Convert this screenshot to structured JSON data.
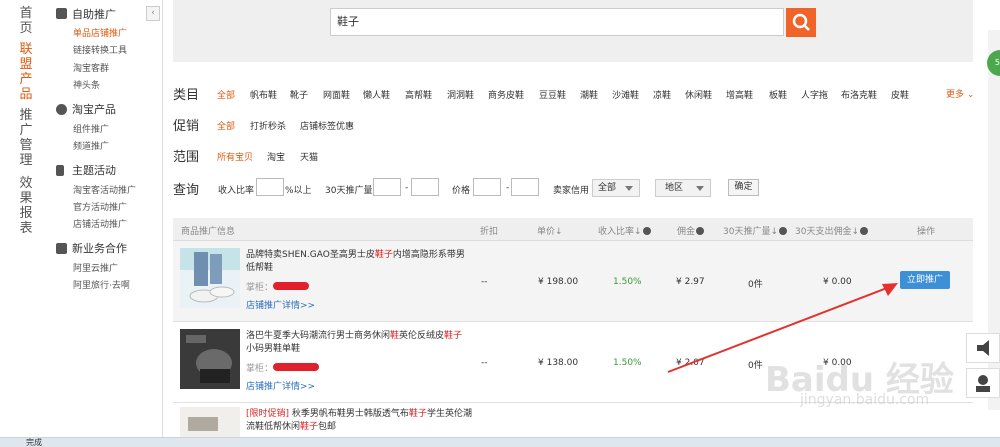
{
  "left_nav": [
    {
      "label": "首页",
      "active": false
    },
    {
      "label": "联盟产品",
      "active": true
    },
    {
      "label": "推广管理",
      "active": false
    },
    {
      "label": "效果报表",
      "active": false
    }
  ],
  "sidebar": {
    "sections": [
      {
        "title": "自助推广",
        "icon": "megaphone-icon",
        "items": [
          {
            "label": "单品店铺推广",
            "active": true
          },
          {
            "label": "链接转换工具",
            "active": false
          },
          {
            "label": "淘宝客群",
            "active": false
          },
          {
            "label": "神头条",
            "active": false
          }
        ]
      },
      {
        "title": "淘宝产品",
        "icon": "taobao-icon",
        "items": [
          {
            "label": "组件推广",
            "active": false
          },
          {
            "label": "频道推广",
            "active": false
          }
        ]
      },
      {
        "title": "主题活动",
        "icon": "flag-icon",
        "items": [
          {
            "label": "淘宝客活动推广",
            "active": false
          },
          {
            "label": "官方活动推广",
            "active": false
          },
          {
            "label": "店铺活动推广",
            "active": false
          }
        ]
      },
      {
        "title": "新业务合作",
        "icon": "handshake-icon",
        "items": [
          {
            "label": "阿里云推广",
            "active": false
          },
          {
            "label": "阿里旅行·去啊",
            "active": false
          }
        ]
      }
    ]
  },
  "search": {
    "value": "鞋子",
    "button_icon": "search-icon"
  },
  "filters": {
    "category_label": "类目",
    "categories": [
      "全部",
      "帆布鞋",
      "靴子",
      "网面鞋",
      "懒人鞋",
      "高帮鞋",
      "洞洞鞋",
      "商务皮鞋",
      "豆豆鞋",
      "潮鞋",
      "沙滩鞋",
      "凉鞋",
      "休闲鞋",
      "增高鞋",
      "板鞋",
      "人字拖",
      "布洛克鞋",
      "皮鞋"
    ],
    "more_label": "更多",
    "promo_label": "促销",
    "promos": [
      "全部",
      "打折秒杀",
      "店铺标签优惠"
    ],
    "scope_label": "范围",
    "scopes": [
      "所有宝贝",
      "淘宝",
      "天猫"
    ],
    "query_label": "查询",
    "ratio_label": "收入比率",
    "ratio_suffix": "%以上",
    "volume_label": "30天推广量",
    "price_label": "价格",
    "dash": "-",
    "credit_label": "卖家信用",
    "credit_value": "全部",
    "region_value": "地区",
    "confirm_label": "确定"
  },
  "table": {
    "headers": {
      "info": "商品推广信息",
      "discount": "折扣",
      "price": "单价",
      "ratio": "收入比率",
      "commission": "佣金",
      "volume": "30天推广量",
      "spend": "30天支出佣金",
      "action": "操作"
    },
    "rows": [
      {
        "title_parts": [
          "品牌特卖SHEN.GAO圣高男士皮",
          "鞋",
          "内增高隐形系带男低帮鞋"
        ],
        "title_hl": "鞋子",
        "seller_label": "掌柜：",
        "link": "店铺推广详情>>",
        "discount": "--",
        "price": "¥ 198.00",
        "ratio": "1.50%",
        "commission": "¥ 2.97",
        "volume": "0件",
        "spend": "¥ 0.00",
        "action": "立即推广"
      },
      {
        "title_a": "洛巴牛夏季大码潮流行男士商务休闲",
        "title_b": "英伦反绒皮",
        "title_c": "小码男鞋单鞋",
        "title_hl": "鞋子",
        "seller_label": "掌柜：",
        "link": "店铺推广详情>>",
        "discount": "--",
        "price": "¥ 138.00",
        "ratio": "1.50%",
        "commission": "¥ 2.07",
        "volume": "0件",
        "spend": "¥ 0.00"
      },
      {
        "tag": "[限时促销]",
        "title_a": "秋季男帆布鞋男士韩版透气布",
        "title_hl": "鞋子",
        "title_b": "学生英伦潮流鞋低帮休闲",
        "title_c": "包邮"
      }
    ]
  },
  "status": {
    "text": "完成"
  },
  "watermark": {
    "text": "Baidu 经验",
    "sub": "jingyan.baidu.com"
  },
  "accent_color": "#e05a10",
  "button_color": "#3d8fd6"
}
